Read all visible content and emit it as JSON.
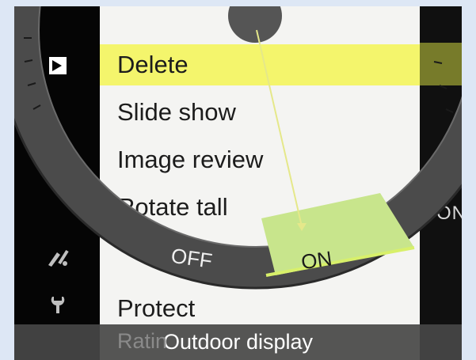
{
  "menu": {
    "items": [
      {
        "label": "Delete",
        "selected": true
      },
      {
        "label": "Slide show",
        "selected": false
      },
      {
        "label": "Image review",
        "selected": false
      },
      {
        "label": "Rotate tall",
        "selected": false
      },
      {
        "label": "",
        "selected": false
      },
      {
        "label": "Protect",
        "selected": false
      }
    ],
    "ghost_item": "Ratin"
  },
  "dial": {
    "off_label": "OFF",
    "on_label": "ON",
    "selected": "ON"
  },
  "right_strip": {
    "value": "ON"
  },
  "bottom_bar": {
    "label": "Outdoor display"
  },
  "sidebar": {
    "icons": [
      "playback-icon",
      "retouch-icon",
      "wrench-icon"
    ]
  },
  "colors": {
    "highlight": "#f4f56c",
    "dial_on": "#c8e58c",
    "dial_ring": "#4a4a4a",
    "background": "#dde7f5"
  }
}
